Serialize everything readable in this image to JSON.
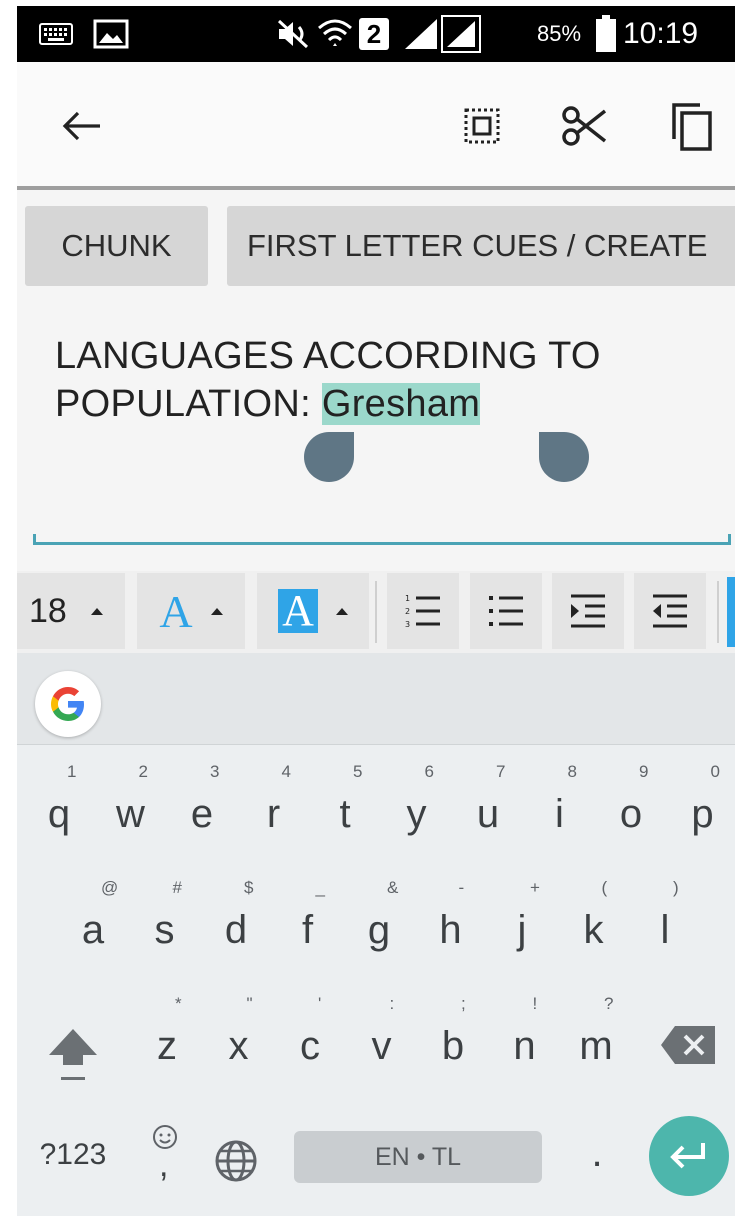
{
  "status_bar": {
    "battery_percent": "85%",
    "sim_slot": "2",
    "time": "10:19"
  },
  "action_bar": {
    "back_icon": "arrow-left-icon",
    "select_all_icon": "select-all-icon",
    "cut_icon": "scissors-icon",
    "copy_icon": "copy-icon"
  },
  "chips": [
    {
      "label": "CHUNK"
    },
    {
      "label": "FIRST LETTER CUES / CREATE"
    }
  ],
  "editor": {
    "line1": "LANGUAGES ACCORDING TO",
    "line2_prefix": "POPULATION: ",
    "selected_word": "Gresham"
  },
  "format_toolbar": {
    "font_size": "18",
    "text_color_letter": "A",
    "highlight_letter": "A",
    "text_color": "#2fa4e7"
  },
  "keyboard": {
    "suggestion_icon": "google-g-icon",
    "row1": [
      {
        "key": "q",
        "hint": "1"
      },
      {
        "key": "w",
        "hint": "2"
      },
      {
        "key": "e",
        "hint": "3"
      },
      {
        "key": "r",
        "hint": "4"
      },
      {
        "key": "t",
        "hint": "5"
      },
      {
        "key": "y",
        "hint": "6"
      },
      {
        "key": "u",
        "hint": "7"
      },
      {
        "key": "i",
        "hint": "8"
      },
      {
        "key": "o",
        "hint": "9"
      },
      {
        "key": "p",
        "hint": "0"
      }
    ],
    "row2": [
      {
        "key": "a",
        "hint": "@"
      },
      {
        "key": "s",
        "hint": "#"
      },
      {
        "key": "d",
        "hint": "$"
      },
      {
        "key": "f",
        "hint": "_"
      },
      {
        "key": "g",
        "hint": "&"
      },
      {
        "key": "h",
        "hint": "-"
      },
      {
        "key": "j",
        "hint": "+"
      },
      {
        "key": "k",
        "hint": "("
      },
      {
        "key": "l",
        "hint": ")"
      }
    ],
    "row3": [
      {
        "key": "z",
        "hint": "*"
      },
      {
        "key": "x",
        "hint": "\""
      },
      {
        "key": "c",
        "hint": "'"
      },
      {
        "key": "v",
        "hint": ":"
      },
      {
        "key": "b",
        "hint": ";"
      },
      {
        "key": "n",
        "hint": "!"
      },
      {
        "key": "m",
        "hint": "?"
      }
    ],
    "symbols_label": "?123",
    "emoji_comma": ",",
    "space_label": "EN • TL",
    "period": ".",
    "accent_color": "#4db6ac"
  }
}
